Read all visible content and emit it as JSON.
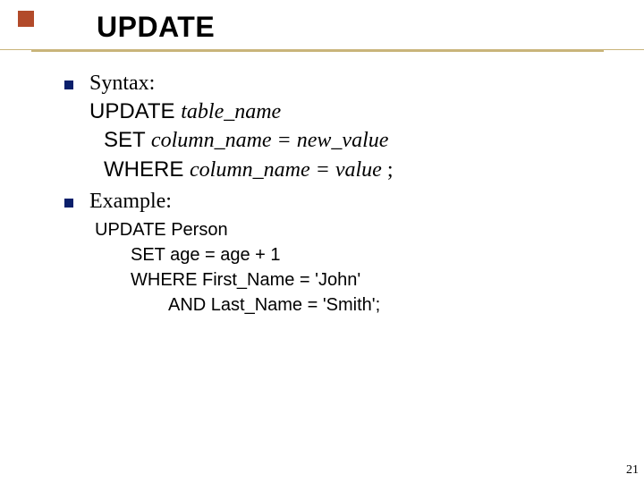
{
  "title": "UPDATE",
  "bullets": [
    {
      "label": "Syntax:"
    },
    {
      "label": "Example:"
    }
  ],
  "syntax": {
    "line1_kw": "UPDATE ",
    "line1_it": "table_name",
    "line2_kw": "SET ",
    "line2_it": "column_name = new_value",
    "line3_kw": "WHERE ",
    "line3_it": "column_name = value ",
    "line3_end": ";"
  },
  "example": {
    "l1": "UPDATE Person",
    "l2": "SET age = age + 1",
    "l3": "WHERE First_Name = 'John'",
    "l4": "AND Last_Name = 'Smith';"
  },
  "page_number": "21"
}
